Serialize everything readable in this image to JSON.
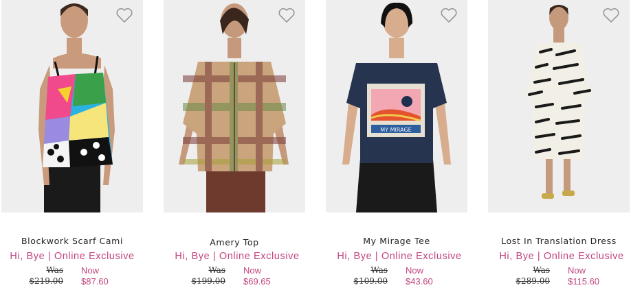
{
  "products": [
    {
      "name": "Blockwork Scarf Cami",
      "promo": "Hi, Bye | Online Exclusive",
      "was_label": "Was",
      "was_price": "$219.00",
      "now_label": "Now",
      "now_price": "$87.60",
      "image": "model-wearing-colourful-blockwork-cami"
    },
    {
      "name": "Amery Top",
      "promo": "Hi, Bye | Online Exclusive",
      "was_label": "Was",
      "was_price": "$199.00",
      "now_label": "Now",
      "now_price": "$69.65",
      "image": "model-wearing-plaid-sheer-top"
    },
    {
      "name": "My Mirage Tee",
      "promo": "Hi, Bye | Online Exclusive",
      "was_label": "Was",
      "was_price": "$109.00",
      "now_label": "Now",
      "now_price": "$43.60",
      "image": "model-wearing-navy-graphic-tee"
    },
    {
      "name": "Lost In Translation Dress",
      "promo": "Hi, Bye | Online Exclusive",
      "was_label": "Was",
      "was_price": "$289.00",
      "now_label": "Now",
      "now_price": "$115.60",
      "image": "model-wearing-black-white-print-dress"
    }
  ],
  "colors": {
    "accent": "#c2457e",
    "text": "#222222",
    "image_bg": "#eeeeee"
  },
  "icons": {
    "wishlist": "heart-icon"
  }
}
